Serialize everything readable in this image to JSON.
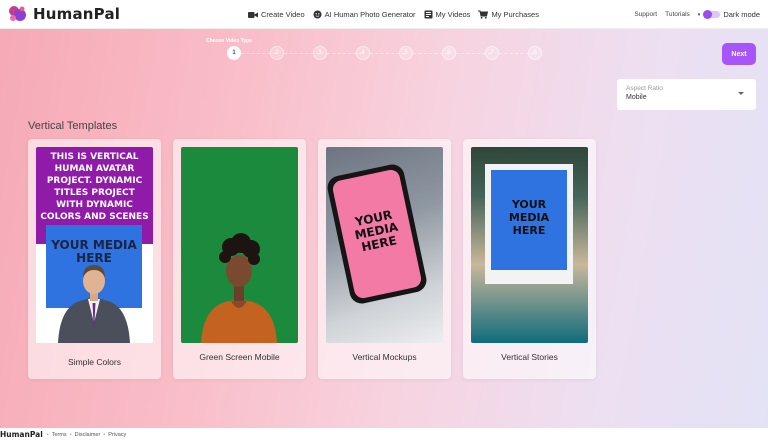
{
  "app": {
    "brand": "HumanPal"
  },
  "nav": {
    "items": [
      {
        "label": "Create Video",
        "icon": "video-camera-icon"
      },
      {
        "label": "AI Human Photo Generator",
        "icon": "face-icon"
      },
      {
        "label": "My Videos",
        "icon": "video-library-icon"
      },
      {
        "label": "My Purchases",
        "icon": "cart-icon"
      }
    ]
  },
  "header_right": {
    "support": "Support",
    "tutorials": "Tutorials",
    "dark_mode": "Dark mode"
  },
  "stepper": {
    "title": "Choose Video Type",
    "steps": [
      "1",
      "2",
      "3",
      "4",
      "5",
      "6",
      "7",
      "8"
    ],
    "active": 1
  },
  "next_button": "Next",
  "aspect_ratio": {
    "label": "Aspect Ratio",
    "value": "Mobile"
  },
  "section_title": "Vertical Templates",
  "templates": [
    {
      "label": "Simple Colors",
      "headline": "THIS IS VERTICAL HUMAN AVATAR PROJECT. DYNAMIC TITLES PROJECT WITH DYNAMIC COLORS AND SCENES",
      "media_text": "YOUR MEDIA HERE"
    },
    {
      "label": "Green Screen Mobile"
    },
    {
      "label": "Vertical Mockups",
      "media_text": "YOUR MEDIA HERE"
    },
    {
      "label": "Vertical Stories",
      "media_text": "YOUR MEDIA HERE"
    }
  ],
  "footer": {
    "brand": "HumanPal",
    "links": [
      "Terms",
      "Disclaimer",
      "Privacy"
    ]
  },
  "colors": {
    "accent": "#a855f7",
    "green_screen": "#1c8a3c",
    "media_blue": "#2f73e0",
    "template_purple": "#8f1ba8"
  }
}
